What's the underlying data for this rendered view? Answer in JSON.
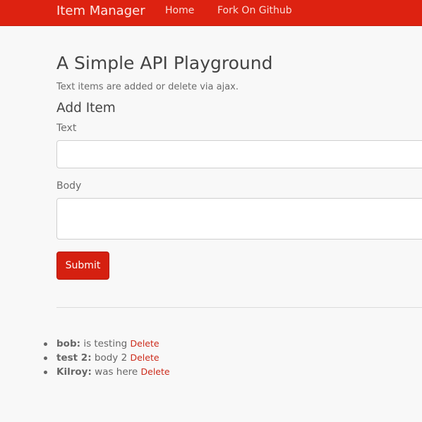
{
  "navbar": {
    "brand": "Item Manager",
    "links": [
      {
        "label": "Home"
      },
      {
        "label": "Fork On Github"
      }
    ]
  },
  "page": {
    "title": "A Simple API Playground",
    "subtitle": "Text items are added or delete via ajax."
  },
  "form": {
    "heading": "Add Item",
    "text_label": "Text",
    "text_value": "",
    "body_label": "Body",
    "body_value": "",
    "submit_label": "Submit"
  },
  "items": [
    {
      "name": "bob:",
      "text": "is testing",
      "delete_label": "Delete"
    },
    {
      "name": "test 2:",
      "text": "body 2",
      "delete_label": "Delete"
    },
    {
      "name": "Kilroy:",
      "text": "was here",
      "delete_label": "Delete"
    }
  ],
  "colors": {
    "accent": "#dd2211",
    "button": "#d52010",
    "link": "#cc2a1a",
    "background": "#f8f8f8"
  }
}
